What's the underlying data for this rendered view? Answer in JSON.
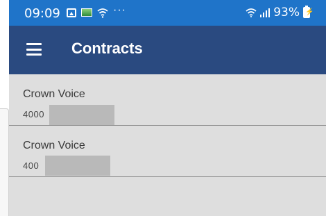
{
  "status_bar": {
    "time": "09:09",
    "battery": "93%",
    "more": "···"
  },
  "app_bar": {
    "title": "Contracts"
  },
  "contracts": [
    {
      "name": "Crown Voice",
      "number": "4000"
    },
    {
      "name": "Crown Voice",
      "number": "400"
    }
  ],
  "colors": {
    "status_bar": "#1f74c9",
    "app_bar": "#2a4a80",
    "background": "#dedede"
  }
}
